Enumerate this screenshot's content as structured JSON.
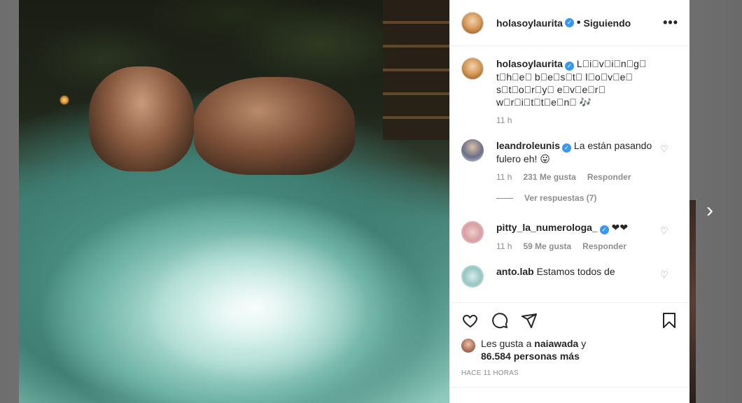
{
  "post": {
    "author": "holasoylaurita",
    "follow_dot": "•",
    "follow_label": "Siguiendo",
    "more_label": "•••"
  },
  "caption": {
    "author": "holasoylaurita",
    "text": "L⃣i⃣v⃣i⃣n⃣g⃣ t⃣h⃣e⃣ b⃣e⃣s⃣t⃣ l⃣o⃣v⃣e⃣ s⃣t⃣o⃣r⃣y⃣ e⃣v⃣e⃣r⃣ w⃣r⃣i⃣t⃣t⃣e⃣n⃣ ",
    "emoji": "🎶",
    "time": "11 h"
  },
  "comments": [
    {
      "user": "leandroleunis",
      "verified": true,
      "text": "La están pasando fulero eh!",
      "emoji": "😛",
      "time": "11 h",
      "likes": "231 Me gusta",
      "reply": "Responder"
    },
    {
      "user": "pitty_la_numerologa_",
      "verified": true,
      "text": "",
      "emoji": "❤❤",
      "time": "11 h",
      "likes": "59 Me gusta",
      "reply": "Responder"
    },
    {
      "user": "anto.lab",
      "verified": false,
      "text": "Estamos todos de",
      "emoji": ""
    }
  ],
  "view_replies": "Ver respuestas (7)",
  "likes_summary": {
    "prefix": "Les gusta a",
    "user": "naiawada",
    "connector": "y",
    "count": "86.584 personas más"
  },
  "time_ago": "HACE 11 HORAS",
  "icons": {
    "verified": "✓",
    "heart_small": "♡",
    "next": "›"
  }
}
